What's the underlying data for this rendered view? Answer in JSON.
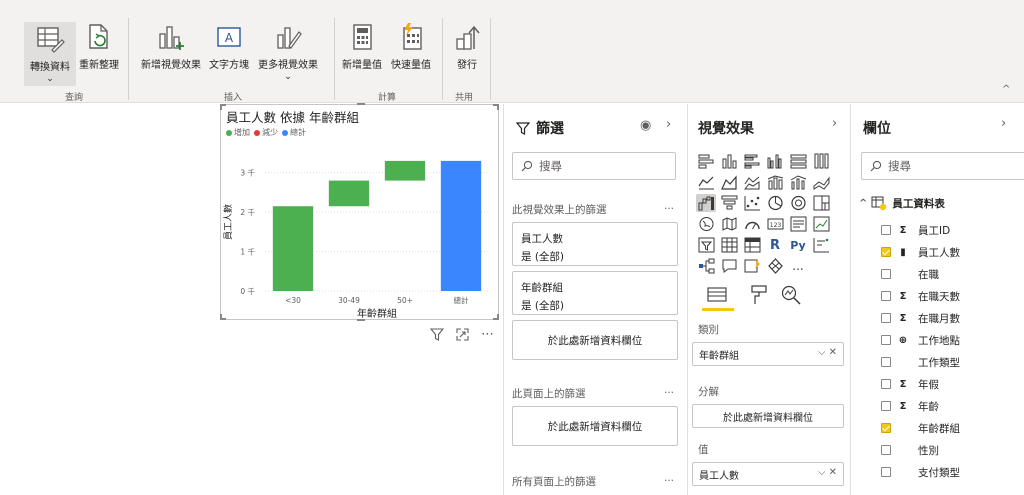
{
  "ribbon": {
    "transform_label": "轉換資料",
    "refresh_label": "重新整理",
    "new_visual_label": "新增視覺效果",
    "textbox_label": "文字方塊",
    "more_visuals_label": "更多視覺效果",
    "new_measure_label": "新增量值",
    "quick_measure_label": "快速量值",
    "publish_label": "發行",
    "groups": {
      "query": "查詢",
      "insert": "插入",
      "calc": "計算",
      "share": "共用"
    },
    "caret": "⌄"
  },
  "visual": {
    "title": "員工人數 依據 年齡群組",
    "legend": [
      {
        "label": "增加",
        "color": "#4caf50"
      },
      {
        "label": "減少",
        "color": "#e53935"
      },
      {
        "label": "總計",
        "color": "#3a86ff"
      }
    ],
    "chart_data": {
      "type": "bar",
      "subtype": "waterfall",
      "categories": [
        "<30",
        "30-49",
        "50+",
        "總計"
      ],
      "values": [
        2150,
        650,
        500,
        3300
      ],
      "bar_kind": [
        "increase",
        "increase",
        "increase",
        "total"
      ],
      "yticks": [
        "0 千",
        "1 千",
        "2 千",
        "3 千"
      ],
      "ylim": [
        0,
        3500
      ],
      "xlabel": "年齡群組",
      "ylabel": "員工人數",
      "grid": true,
      "colors": {
        "increase": "#4caf50",
        "decrease": "#e53935",
        "total": "#3a86ff"
      }
    }
  },
  "filters": {
    "title": "篩選",
    "search_placeholder": "搜尋",
    "visual_section": "此視覺效果上的篩選",
    "more": "...",
    "cards": [
      {
        "field": "員工人數",
        "value": "是 (全部)"
      },
      {
        "field": "年齡群組",
        "value": "是 (全部)"
      }
    ],
    "add_field_label": "於此處新增資料欄位",
    "page_section": "此頁面上的篩選",
    "page_add_label": "於此處新增資料欄位",
    "all_pages_section": "所有頁面上的篩選",
    "all_more": "..."
  },
  "viz": {
    "title": "視覺效果",
    "more": "...",
    "r_label": "R",
    "py_label": "Py",
    "category_label": "類別",
    "category_value": "年齡群組",
    "breakdown_label": "分解",
    "breakdown_placeholder": "於此處新增資料欄位",
    "values_label": "值",
    "values_value": "員工人數",
    "well_controls": "⌵ ✕"
  },
  "fields": {
    "title": "欄位",
    "search_placeholder": "搜尋",
    "table_name": "員工資料表",
    "items": [
      {
        "type": "Σ",
        "label": "員工ID",
        "checked": false
      },
      {
        "type": "▮",
        "label": "員工人數",
        "checked": true
      },
      {
        "type": "",
        "label": "在職",
        "checked": false
      },
      {
        "type": "Σ",
        "label": "在職天數",
        "checked": false
      },
      {
        "type": "Σ",
        "label": "在職月數",
        "checked": false
      },
      {
        "type": "⊕",
        "label": "工作地點",
        "checked": false
      },
      {
        "type": "",
        "label": "工作類型",
        "checked": false
      },
      {
        "type": "Σ",
        "label": "年假",
        "checked": false
      },
      {
        "type": "Σ",
        "label": "年齡",
        "checked": false
      },
      {
        "type": "",
        "label": "年齡群組",
        "checked": true
      },
      {
        "type": "",
        "label": "性別",
        "checked": false
      },
      {
        "type": "",
        "label": "支付類型",
        "checked": false
      }
    ]
  }
}
